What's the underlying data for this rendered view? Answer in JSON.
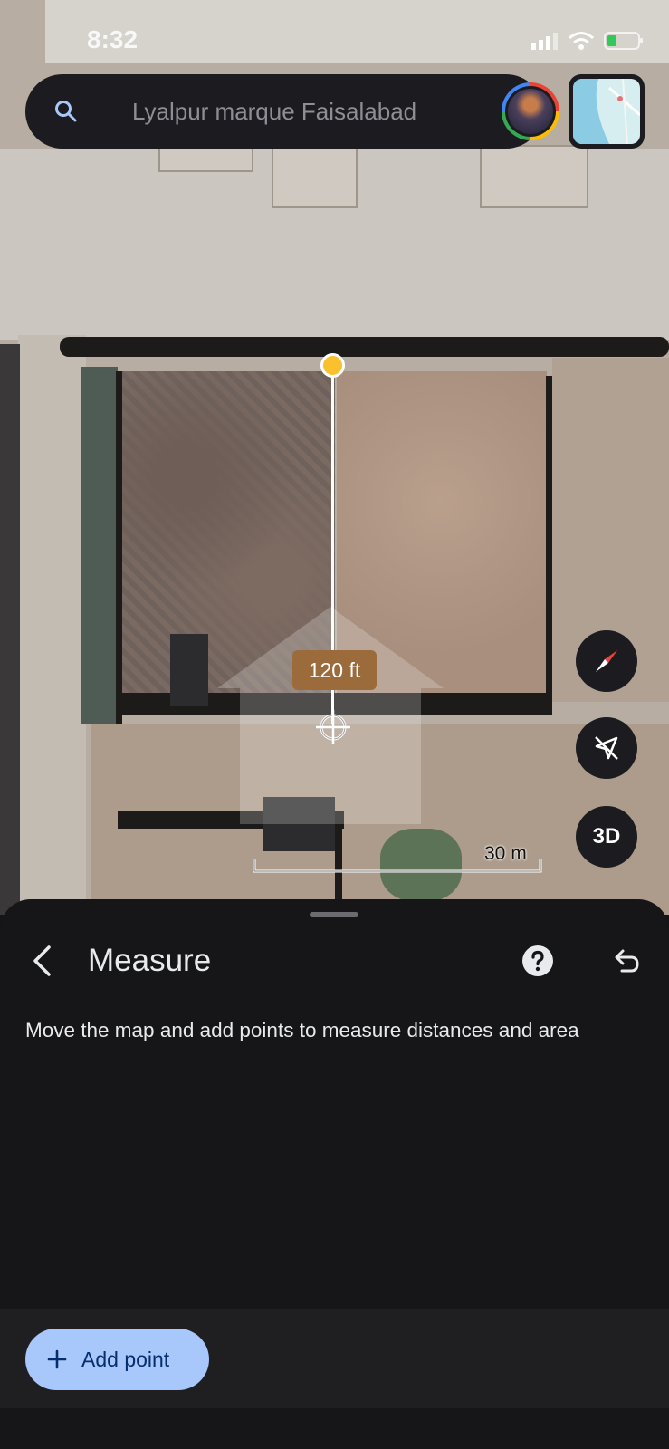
{
  "status_bar": {
    "time": "8:32"
  },
  "search": {
    "placeholder": "Lyalpur marque Faisalabad"
  },
  "map": {
    "measurement_label": "120 ft",
    "scale_label": "30 m",
    "threed_label": "3D"
  },
  "sheet": {
    "title": "Measure",
    "instructions": "Move the map and add points to measure distances and area",
    "add_point_label": "Add point"
  },
  "colors": {
    "accent_button": "#a8c7fa",
    "measure_start_point": "#fbc02d",
    "distance_label_bg": "#9b6b3c",
    "compass_red": "#e8453c"
  },
  "icons": [
    "search-icon",
    "avatar",
    "layers-icon",
    "compass-icon",
    "north-off-icon",
    "back-arrow-icon",
    "help-icon",
    "undo-icon",
    "plus-icon",
    "crosshair-icon"
  ]
}
